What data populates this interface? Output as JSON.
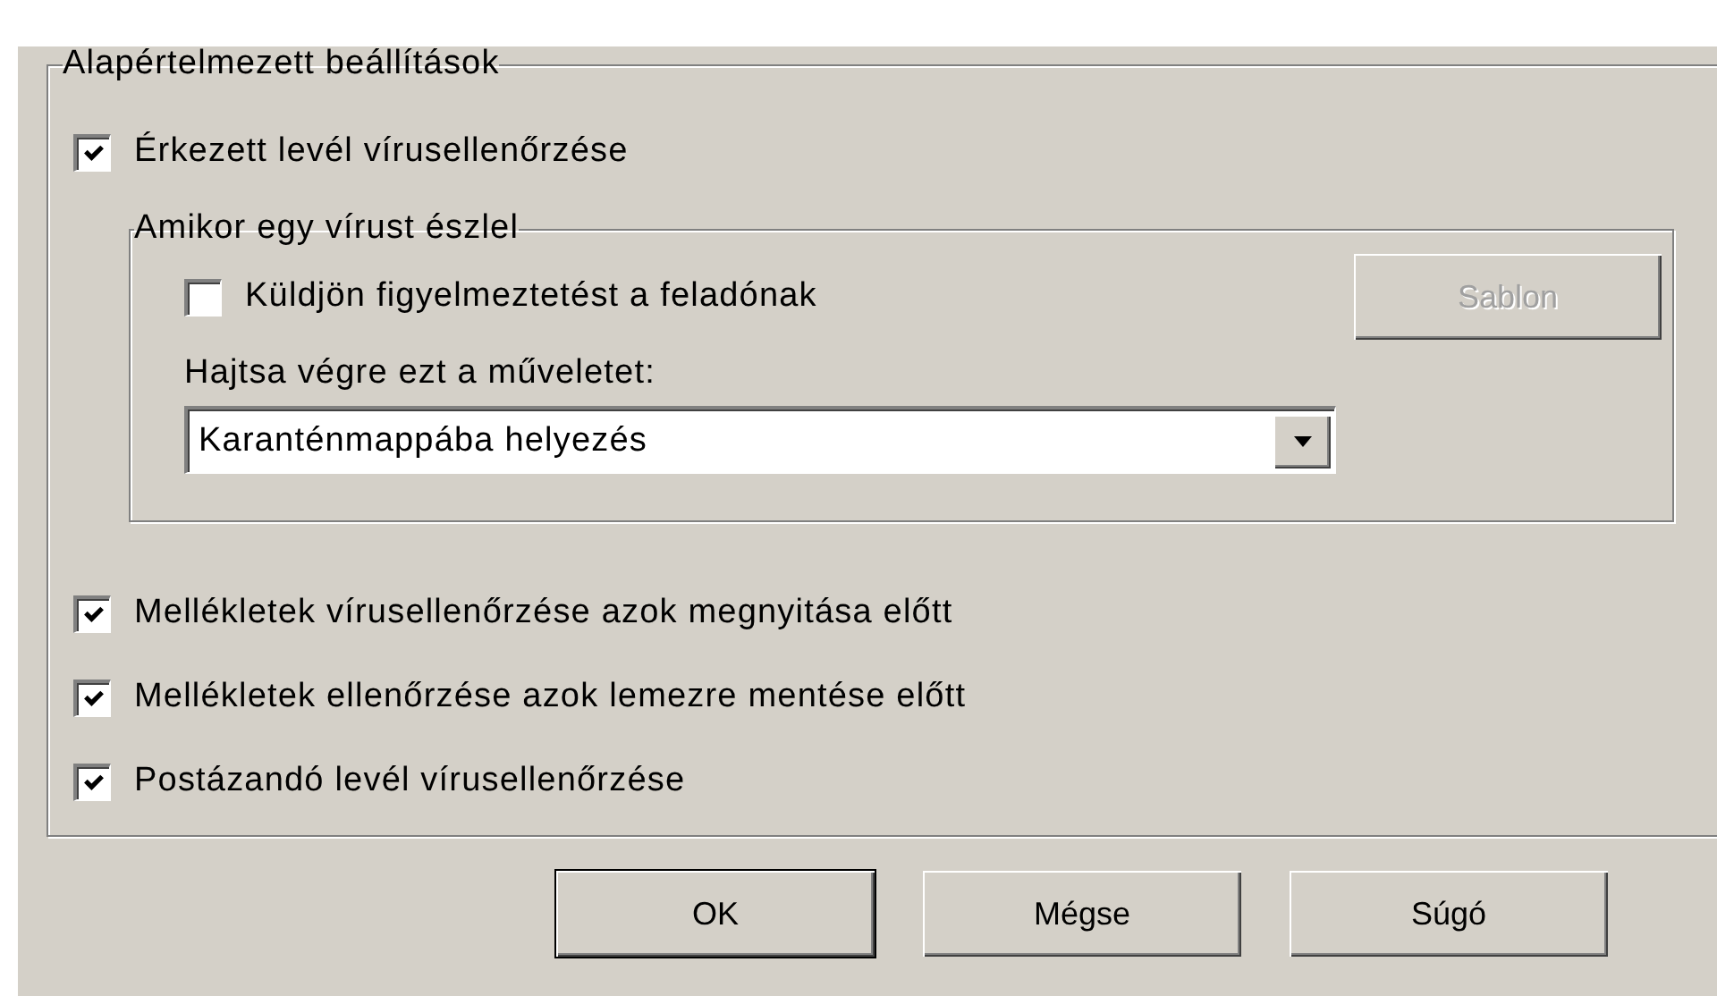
{
  "group": {
    "title": "Alapértelmezett beállítások"
  },
  "scan_incoming": {
    "label": "Érkezett levél vírusellenőrzése",
    "checked": true
  },
  "on_virus": {
    "title": "Amikor egy vírust észlel",
    "notify_sender": {
      "label": "Küldjön figyelmeztetést a feladónak",
      "checked": false
    },
    "template_button": {
      "label": "Sablon",
      "disabled": true
    },
    "action_label": "Hajtsa végre ezt a műveletet:",
    "action_select": {
      "value": "Karanténmappába helyezés"
    }
  },
  "options": [
    {
      "label": "Mellékletek vírusellenőrzése azok megnyitása előtt",
      "checked": true
    },
    {
      "label": "Mellékletek ellenőrzése azok lemezre mentése előtt",
      "checked": true
    },
    {
      "label": "Postázandó levél vírusellenőrzése",
      "checked": true
    }
  ],
  "buttons": [
    {
      "label": "OK",
      "default": true
    },
    {
      "label": "Mégse",
      "default": false
    },
    {
      "label": "Súgó",
      "default": false
    }
  ]
}
